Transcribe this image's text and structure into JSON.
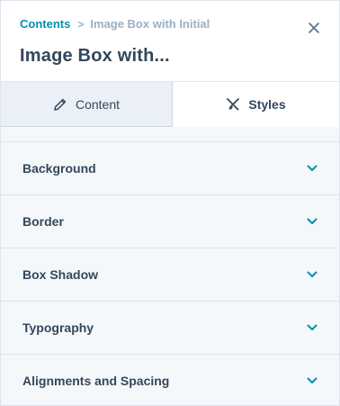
{
  "breadcrumb": {
    "parent": "Contents",
    "separator": ">",
    "current": "Image Box with Initial"
  },
  "title": "Image Box with...",
  "tabs": [
    {
      "label": "Content",
      "icon": "pencil-icon",
      "active": false
    },
    {
      "label": "Styles",
      "icon": "styles-brush-icon",
      "active": true
    }
  ],
  "sections": [
    {
      "label": "Background"
    },
    {
      "label": "Border"
    },
    {
      "label": "Box Shadow"
    },
    {
      "label": "Typography"
    },
    {
      "label": "Alignments and Spacing"
    }
  ],
  "colors": {
    "accent": "#0091ae",
    "text": "#33475b",
    "muted": "#99afc4",
    "panel_bg": "#f5f8fa",
    "inactive_tab_bg": "#eaf0f6"
  }
}
